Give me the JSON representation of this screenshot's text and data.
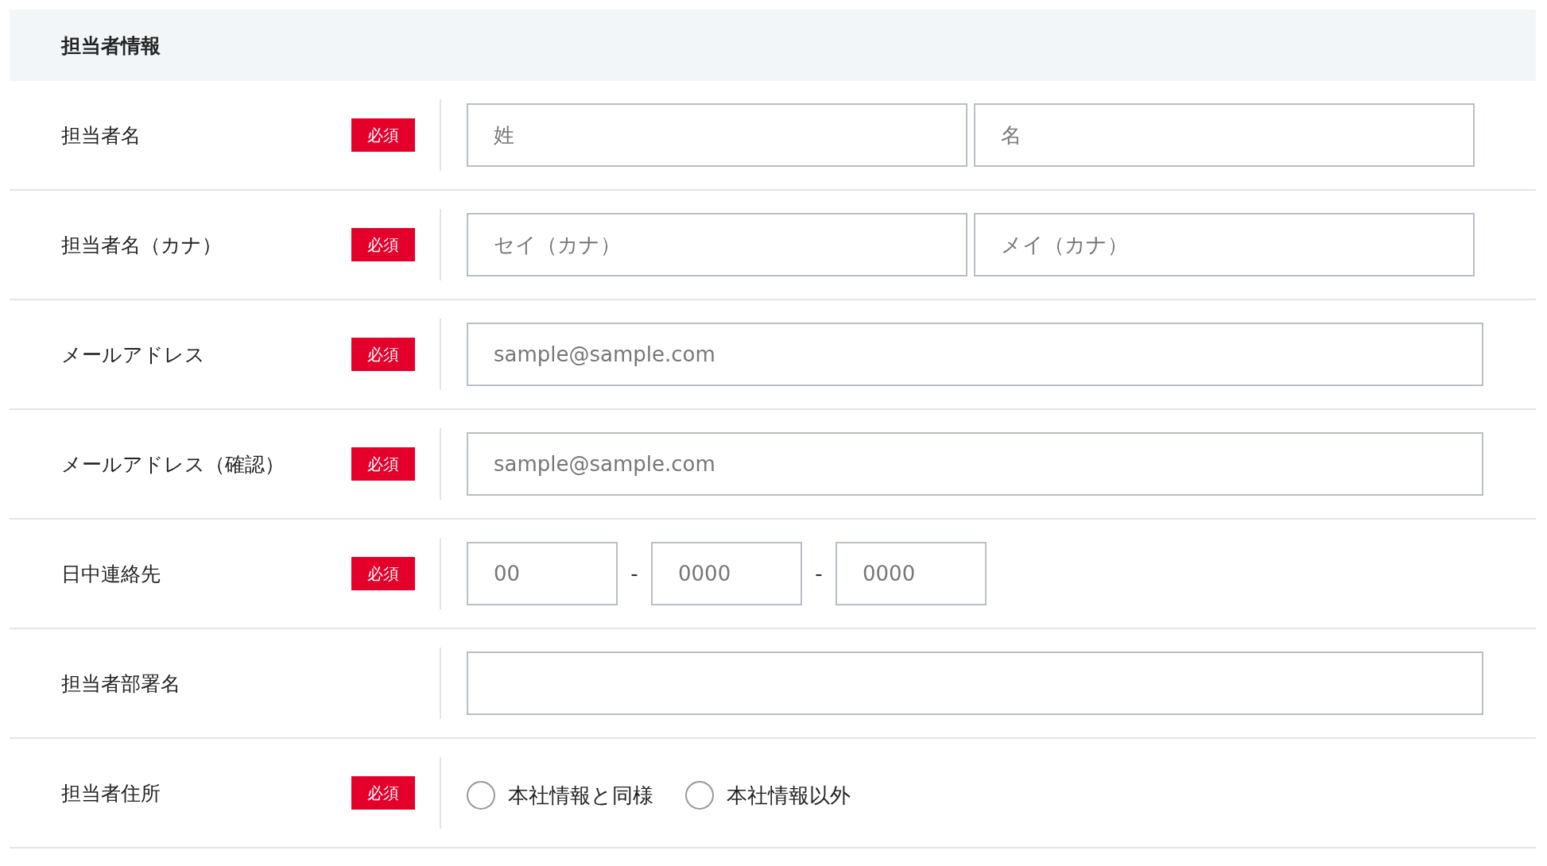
{
  "section": {
    "title": "担当者情報"
  },
  "rows": [
    {
      "label": "担当者名",
      "required": true,
      "badge": "必須",
      "kind": "pair",
      "fields": [
        {
          "placeholder": "姓"
        },
        {
          "placeholder": "名"
        }
      ]
    },
    {
      "label": "担当者名（カナ）",
      "required": true,
      "badge": "必須",
      "kind": "pair",
      "fields": [
        {
          "placeholder": "セイ（カナ）"
        },
        {
          "placeholder": "メイ（カナ）"
        }
      ]
    },
    {
      "label": "メールアドレス",
      "required": true,
      "badge": "必須",
      "kind": "single",
      "fields": [
        {
          "placeholder": "sample@sample.com"
        }
      ]
    },
    {
      "label": "メールアドレス（確認）",
      "required": true,
      "badge": "必須",
      "kind": "single",
      "fields": [
        {
          "placeholder": "sample@sample.com"
        }
      ]
    },
    {
      "label": "日中連絡先",
      "required": true,
      "badge": "必須",
      "kind": "phone",
      "fields": [
        {
          "placeholder": "00"
        },
        {
          "prefix": "-",
          "placeholder": "0000"
        },
        {
          "prefix": "-",
          "placeholder": "0000"
        }
      ]
    },
    {
      "label": "担当者部署名",
      "required": false,
      "kind": "single"
    },
    {
      "label": "担当者住所",
      "required": true,
      "badge": "必須",
      "kind": "radio",
      "options": [
        {
          "label": "本社情報と同様",
          "selected": false
        },
        {
          "label": "本社情報以外",
          "selected": false
        }
      ]
    }
  ]
}
